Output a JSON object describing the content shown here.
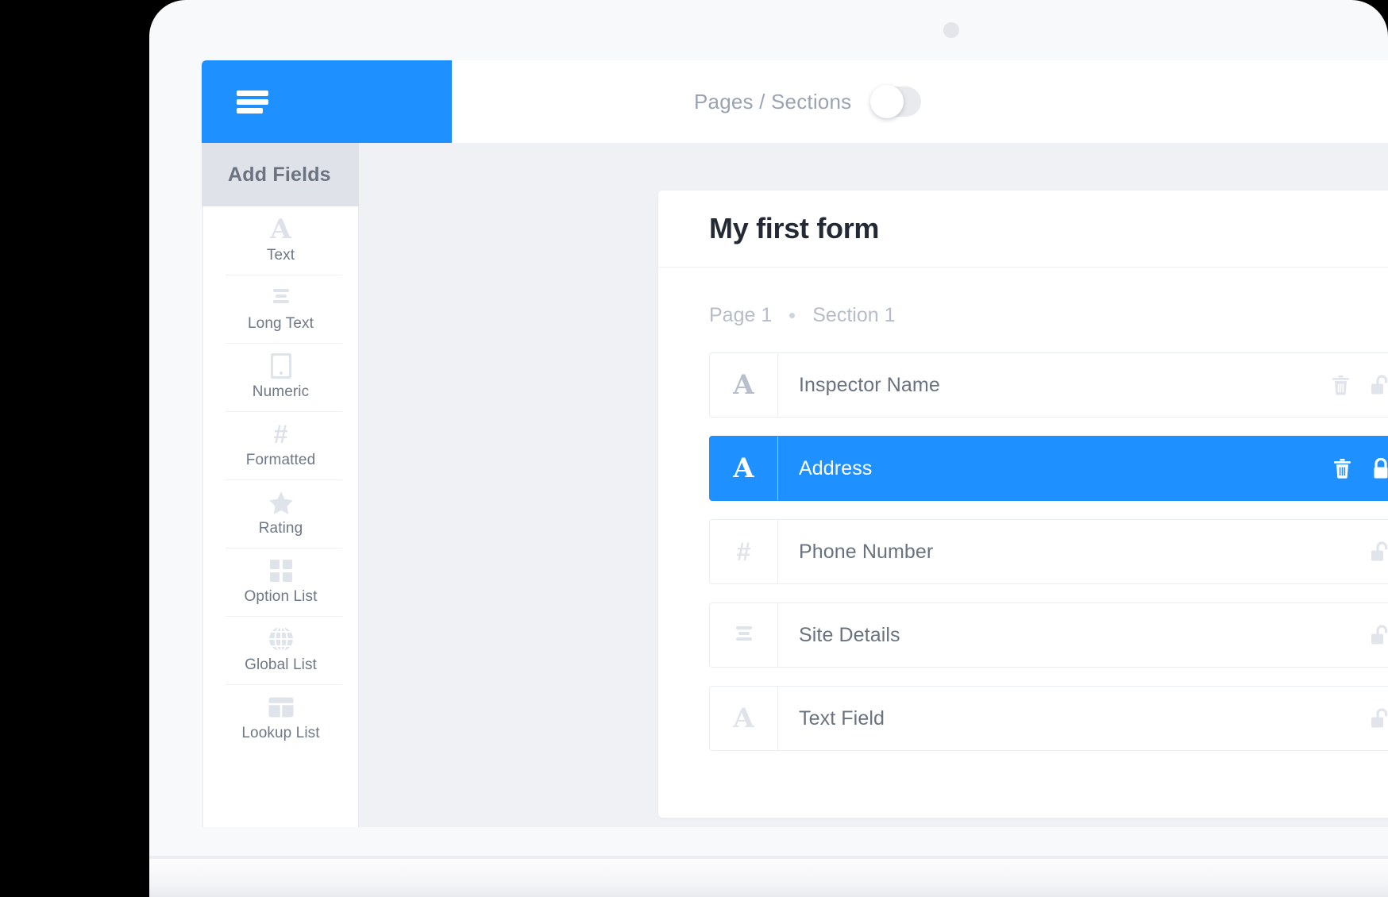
{
  "app": {
    "brand_blue": "#1e90ff",
    "canvas_bg": "#f0f1f5"
  },
  "topbar": {
    "menu_icon": "hamburger-icon",
    "pages_sections_label": "Pages / Sections",
    "toggle": {
      "name": "pages-sections-toggle",
      "state": "off"
    }
  },
  "palette": {
    "header": "Add Fields",
    "items": [
      {
        "label": "Text",
        "icon": "letter-a-icon"
      },
      {
        "label": "Long Text",
        "icon": "paragraph-lines-icon"
      },
      {
        "label": "Numeric",
        "icon": "tablet-device-icon"
      },
      {
        "label": "Formatted",
        "icon": "hash-icon"
      },
      {
        "label": "Rating",
        "icon": "star-icon"
      },
      {
        "label": "Option List",
        "icon": "grid-squares-icon"
      },
      {
        "label": "Global List",
        "icon": "globe-icon"
      },
      {
        "label": "Lookup List",
        "icon": "table-icon"
      }
    ]
  },
  "form": {
    "title": "My first form",
    "play_button": "play-icon",
    "breadcrumb": {
      "page": "Page 1",
      "separator": "•",
      "section": "Section 1"
    },
    "fields": [
      {
        "label": "Inspector Name",
        "type_icon": "letter-a-icon",
        "selected": false,
        "actions": [
          "delete-icon",
          "unlock-icon",
          "chart-line-icon"
        ]
      },
      {
        "label": "Address",
        "type_icon": "letter-a-icon",
        "selected": true,
        "actions": [
          "delete-icon",
          "lock-icon",
          "chart-line-icon"
        ]
      },
      {
        "label": "Phone Number",
        "type_icon": "hash-icon",
        "selected": false,
        "actions": [
          "unlock-icon",
          "chart-line-icon"
        ]
      },
      {
        "label": "Site Details",
        "type_icon": "paragraph-lines-icon",
        "selected": false,
        "actions": [
          "unlock-icon",
          "chart-line-icon"
        ]
      },
      {
        "label": "Text Field",
        "type_icon": "letter-a-icon",
        "selected": false,
        "actions": [
          "unlock-icon",
          "chart-line-icon"
        ]
      }
    ]
  }
}
